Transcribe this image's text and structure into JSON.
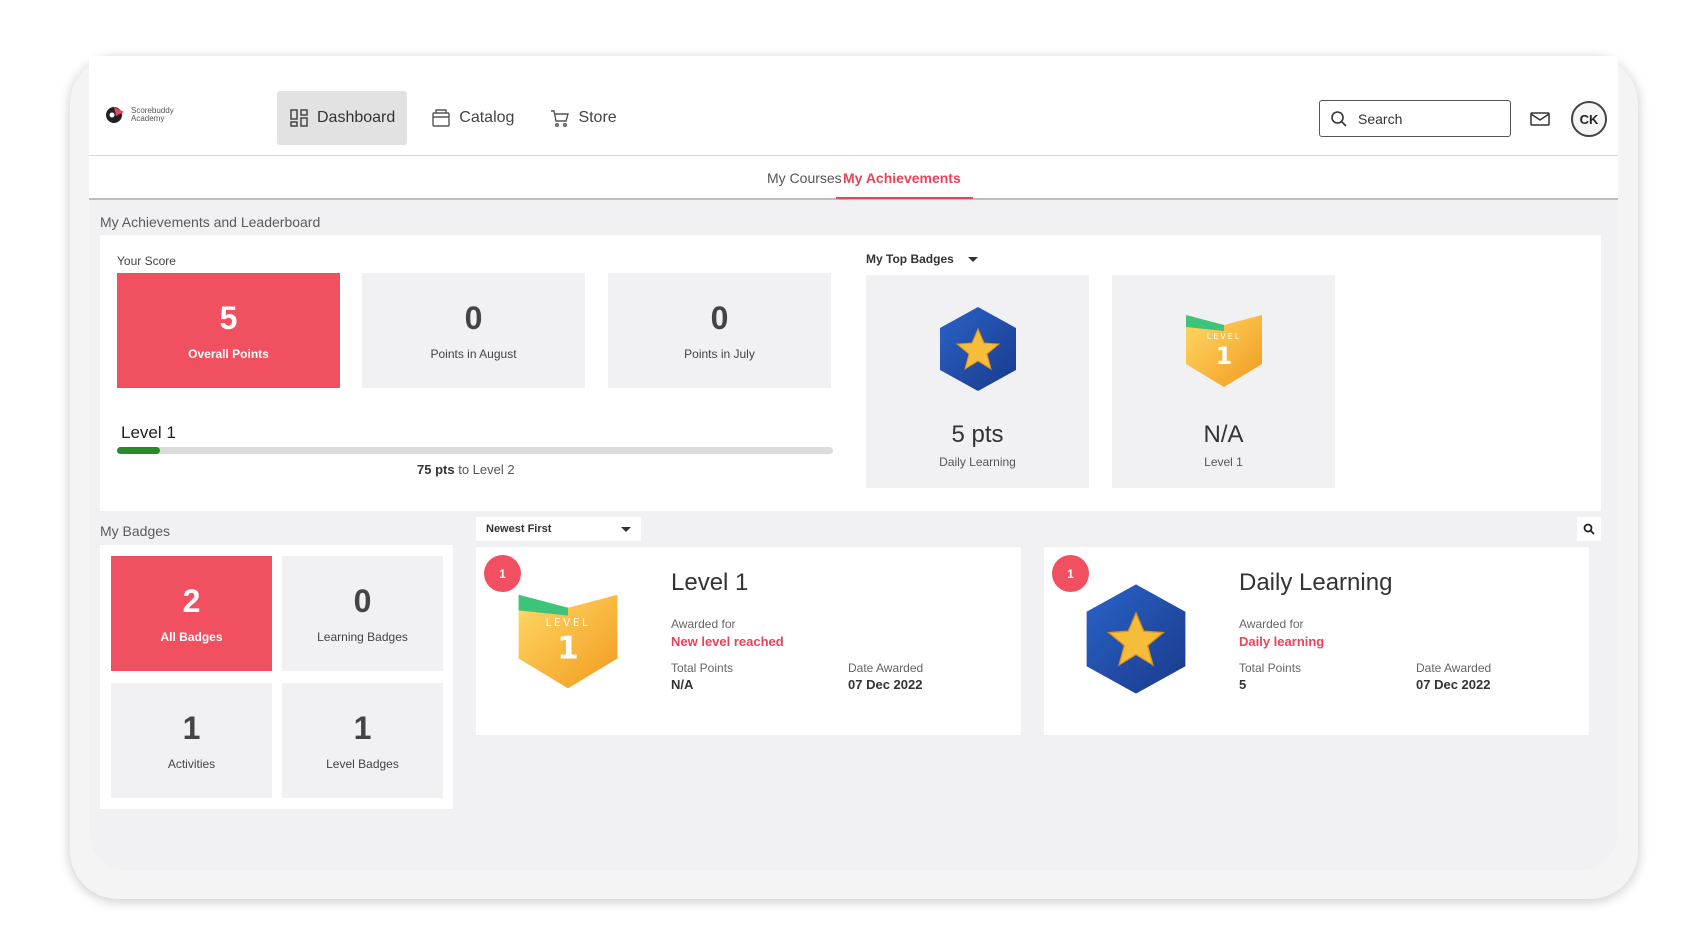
{
  "logo": {
    "text_line1": "Scorebuddy",
    "text_line2": "Academy"
  },
  "nav": {
    "items": [
      {
        "label": "Dashboard",
        "icon": "dashboard-icon",
        "active": true
      },
      {
        "label": "Catalog",
        "icon": "catalog-icon",
        "active": false
      },
      {
        "label": "Store",
        "icon": "cart-icon",
        "active": false
      }
    ]
  },
  "header": {
    "search_placeholder": "Search",
    "avatar_initials": "CK"
  },
  "subtabs": {
    "my_courses": "My Courses",
    "my_achievements": "My Achievements"
  },
  "achievements": {
    "section_title": "My Achievements and Leaderboard",
    "your_score_label": "Your Score",
    "scores": [
      {
        "value": "5",
        "label": "Overall Points",
        "highlight": true
      },
      {
        "value": "0",
        "label": "Points in August",
        "highlight": false
      },
      {
        "value": "0",
        "label": "Points in July",
        "highlight": false
      }
    ],
    "level_label": "Level 1",
    "progress_fraction": 0.06,
    "progress_pts": "75 pts",
    "progress_to": "to Level 2"
  },
  "top_badges": {
    "dropdown_label": "My Top Badges",
    "cards": [
      {
        "value": "5 pts",
        "label": "Daily Learning",
        "icon": "star-hexagon-icon"
      },
      {
        "value": "N/A",
        "label": "Level 1",
        "icon": "level-shield-icon"
      }
    ]
  },
  "my_badges": {
    "section_title": "My Badges",
    "counts": [
      {
        "value": "2",
        "label": "All Badges",
        "highlight": true
      },
      {
        "value": "0",
        "label": "Learning Badges",
        "highlight": false
      },
      {
        "value": "1",
        "label": "Activities",
        "highlight": false
      },
      {
        "value": "1",
        "label": "Level Badges",
        "highlight": false
      }
    ],
    "sort_label": "Newest First",
    "badges": [
      {
        "count": "1",
        "title": "Level 1",
        "awarded_for_label": "Awarded for",
        "awarded_for": "New level reached",
        "total_points_label": "Total Points",
        "total_points": "N/A",
        "date_label": "Date Awarded",
        "date": "07 Dec 2022",
        "icon": "level-shield-icon"
      },
      {
        "count": "1",
        "title": "Daily Learning",
        "awarded_for_label": "Awarded for",
        "awarded_for": "Daily learning",
        "total_points_label": "Total Points",
        "total_points": "5",
        "date_label": "Date Awarded",
        "date": "07 Dec 2022",
        "icon": "star-hexagon-icon"
      }
    ]
  },
  "colors": {
    "accent": "#f0505f",
    "progress": "#2a8a2a",
    "hexagon": "#1f4fa8",
    "star": "#f2b632",
    "shield": "#f5a623",
    "shield_flag": "#3ec47a"
  },
  "level_badge_text": {
    "word": "LEVEL",
    "number": "1"
  }
}
